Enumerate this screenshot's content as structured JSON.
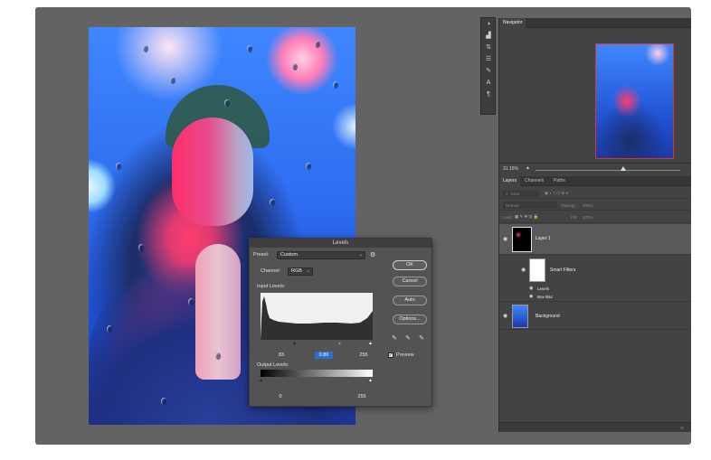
{
  "levels_dialog": {
    "title": "Levels",
    "preset_label": "Preset:",
    "preset_value": "Custom",
    "channel_label": "Channel:",
    "channel_value": "RGB",
    "input_levels_label": "Input Levels:",
    "input_black": "83",
    "input_gamma": "0.80",
    "input_white": "255",
    "output_levels_label": "Output Levels:",
    "output_black": "0",
    "output_white": "255",
    "buttons": {
      "ok": "OK",
      "cancel": "Cancel",
      "auto": "Auto",
      "options": "Options..."
    },
    "preview_label": "Preview",
    "preview_checked": true
  },
  "navigator": {
    "tab": "Navigator",
    "zoom": "31.15%"
  },
  "layers_panel": {
    "tabs": [
      "Layers",
      "Channels",
      "Paths"
    ],
    "filter_placeholder": "Kind",
    "blend_mode": "Normal",
    "opacity_label": "Opacity:",
    "opacity_value": "100%",
    "lock_label": "Lock:",
    "fill_label": "Fill:",
    "fill_value": "100%",
    "layers": [
      {
        "name": "Layer 1"
      },
      {
        "name": "Smart Filters"
      },
      {
        "name": "Levels"
      },
      {
        "name": "Box Blur"
      },
      {
        "name": "Background"
      }
    ]
  },
  "colors": {
    "canvas": "#636363",
    "panel": "#434343",
    "dialog": "#535353"
  }
}
